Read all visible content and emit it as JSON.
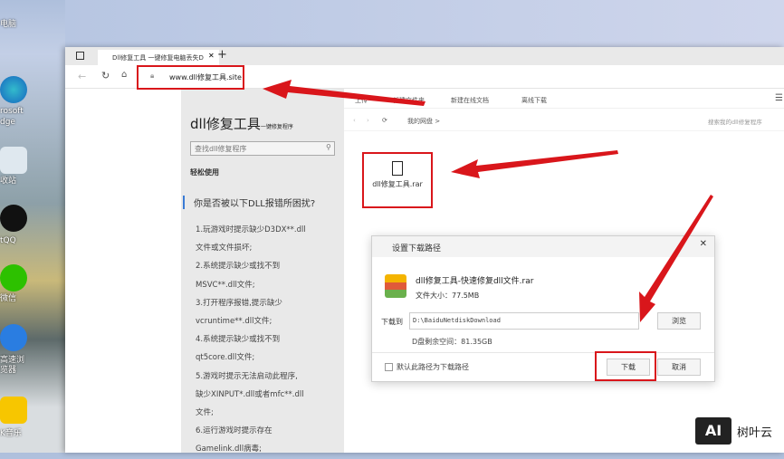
{
  "desktop": {
    "icons": [
      "电脑",
      "rosoft",
      "dge",
      "收站",
      "tQQ",
      "微信",
      "高速浏",
      "览器",
      "K音乐"
    ]
  },
  "browser": {
    "tab_title": "Dll修复工具 一键修复电脑丢失D",
    "new_tab": "+",
    "url": "www.dll修复工具.site"
  },
  "site": {
    "title": "dll修复工具",
    "subtitle": "一键修复程序",
    "search_placeholder": "查找dll修复程序",
    "easy_use": "轻松使用",
    "question": "你是否被以下DLL报错所困扰?",
    "lines": [
      "1.玩游戏时提示缺少D3DX**.dll",
      "文件或文件损坏;",
      "2.系统提示缺少或找不到",
      "MSVC**.dll文件;",
      "3.打开程序报错,提示缺少",
      "vcruntime**.dll文件;",
      "4.系统提示缺少或找不到",
      "qt5core.dll文件;",
      "5.游戏时提示无法启动此程序,",
      "缺少XINPUT*.dll或者mfc**.dll",
      "文件;",
      "6.运行游戏时提示存在",
      "Gamelink.dll病毒;"
    ]
  },
  "netdisk": {
    "toolbar": [
      "上传",
      "新建文件夹",
      "新建在线文档",
      "离线下载"
    ],
    "breadcrumb": "我的网盘 >",
    "search_placeholder": "搜索我的dll修复程序",
    "file_name": "dll修复工具.rar"
  },
  "dialog": {
    "title": "设置下载路径",
    "file_name": "dll修复工具-快速修复dll文件.rar",
    "file_size": "文件大小：77.5MB",
    "download_to_label": "下载到",
    "path": "D:\\BaiduNetdiskDownload",
    "browse": "浏览",
    "free_space": "D盘剩余空间：81.35GB",
    "default_checkbox": "默认此路径为下载路径",
    "download": "下载",
    "cancel": "取消",
    "close": "✕"
  },
  "watermark": {
    "logo": "AI",
    "text": "树叶云"
  },
  "colors": {
    "annotation": "#d9161b"
  }
}
